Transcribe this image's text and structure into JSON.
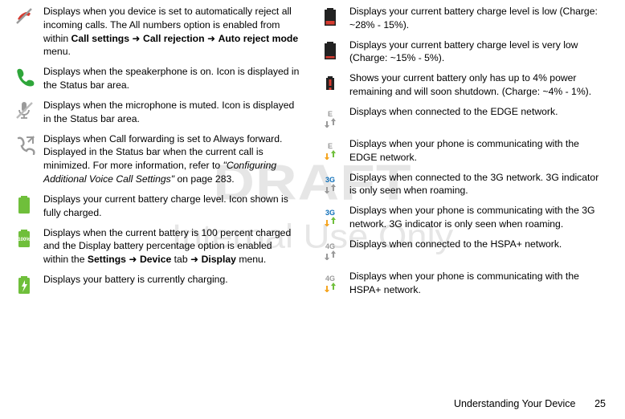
{
  "watermark": {
    "line1": "DRAFT",
    "line2": "Internal Use Only"
  },
  "footer": {
    "section": "Understanding Your Device",
    "page": "25"
  },
  "left": [
    {
      "icon": "reject-call-icon",
      "segments": [
        "Displays when you device is set to automatically reject all incoming calls. The All numbers option is enabled from within ",
        {
          "b": "Call settings"
        },
        " ",
        {
          "arrow": true
        },
        " ",
        {
          "b": "Call rejection"
        },
        " ",
        {
          "arrow": true
        },
        " ",
        {
          "b": "Auto reject mode"
        },
        " menu."
      ]
    },
    {
      "icon": "speakerphone-icon",
      "segments": [
        "Displays when the speakerphone is on. Icon is displayed in the Status bar area."
      ]
    },
    {
      "icon": "mic-muted-icon",
      "segments": [
        "Displays when the microphone is muted. Icon is displayed in the Status bar area."
      ]
    },
    {
      "icon": "call-forwarding-icon",
      "segments": [
        "Displays when Call forwarding is set to Always forward. Displayed in the Status bar when the current call is minimized. For more information, refer to ",
        {
          "i": "\"Configuring Additional Voice Call Settings\""
        },
        " on page 283."
      ]
    },
    {
      "icon": "battery-full-icon",
      "segments": [
        "Displays your current battery charge level. Icon shown is fully charged."
      ]
    },
    {
      "icon": "battery-100pct-icon",
      "segments": [
        "Displays when the current battery is 100 percent charged and the Display battery percentage option is enabled within the ",
        {
          "b": "Settings"
        },
        " ",
        {
          "arrow": true
        },
        " ",
        {
          "b": "Device"
        },
        " tab ",
        {
          "arrow": true
        },
        " ",
        {
          "b": "Display"
        },
        " menu."
      ]
    },
    {
      "icon": "battery-charging-icon",
      "segments": [
        "Displays your battery is currently charging."
      ]
    }
  ],
  "right": [
    {
      "icon": "battery-low-icon",
      "segments": [
        "Displays your current battery charge level is low (Charge: ~28% - 15%)."
      ]
    },
    {
      "icon": "battery-very-low-icon",
      "segments": [
        "Displays your current battery charge level is very low (Charge: ~15% - 5%)."
      ]
    },
    {
      "icon": "battery-critical-icon",
      "segments": [
        "Shows your current battery only has up to 4% power remaining and will soon shutdown. (Charge: ~4% - 1%)."
      ]
    },
    {
      "icon": "edge-connected-icon",
      "segments": [
        "Displays when connected to the EDGE network."
      ]
    },
    {
      "icon": "edge-active-icon",
      "segments": [
        "Displays when your phone is communicating with the EDGE network."
      ]
    },
    {
      "icon": "threeg-connected-icon",
      "segments": [
        "Displays when connected to the 3G network. 3G indicator is only seen when roaming."
      ]
    },
    {
      "icon": "threeg-active-icon",
      "segments": [
        "Displays when your phone is communicating with the 3G network. 3G indicator is only seen when roaming."
      ]
    },
    {
      "icon": "fourg-connected-icon",
      "segments": [
        "Displays when connected to the HSPA+ network."
      ]
    },
    {
      "icon": "fourg-active-icon",
      "segments": [
        "Displays when your phone is communicating with the HSPA+ network."
      ]
    }
  ]
}
